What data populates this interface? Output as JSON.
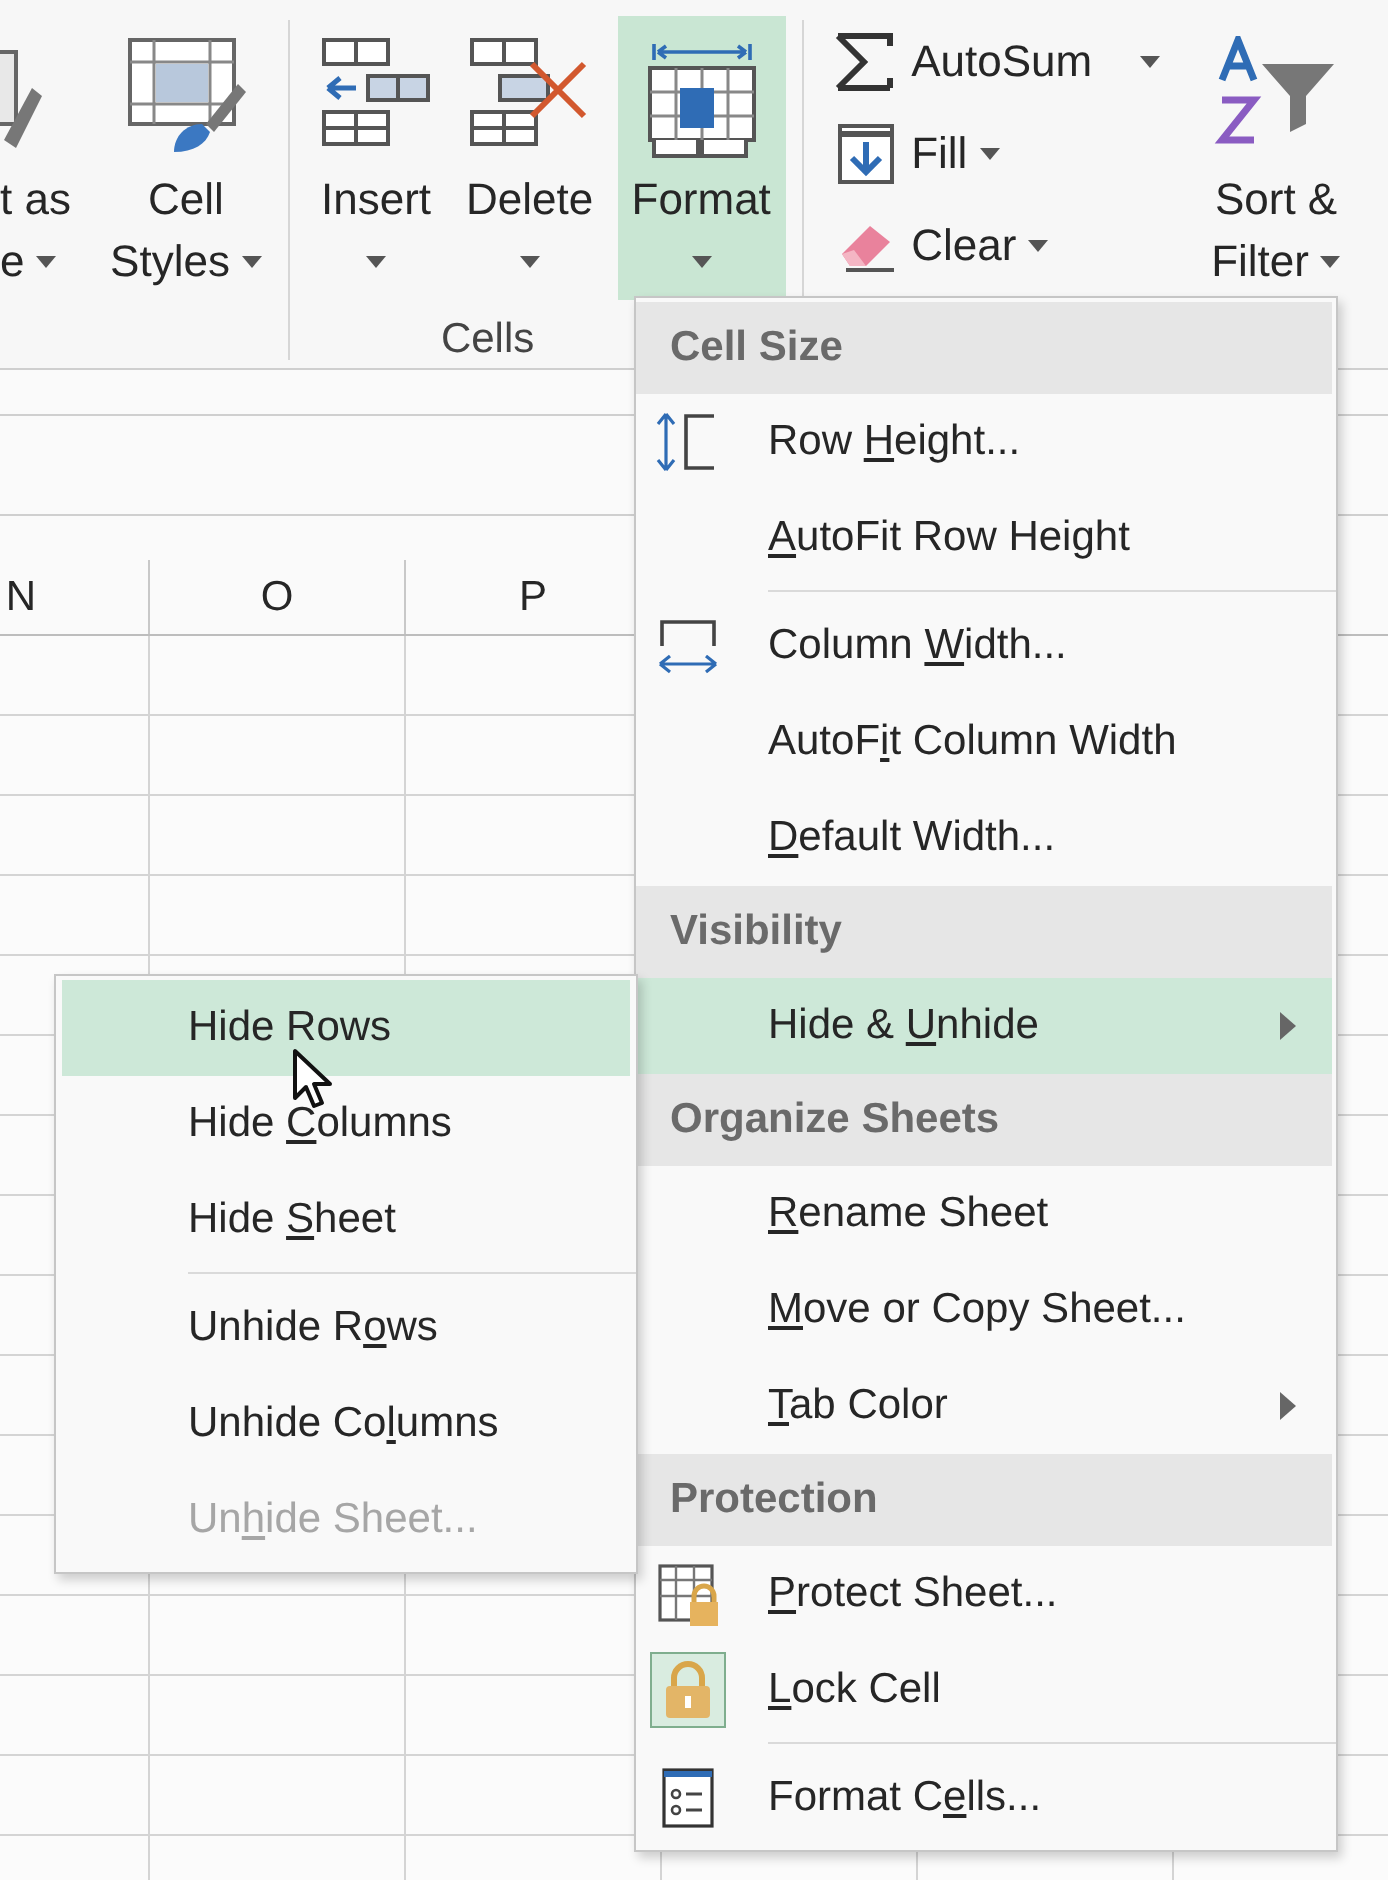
{
  "ribbon": {
    "styles_group": [
      {
        "kind": "table-style",
        "lines": [
          "t as",
          "e"
        ],
        "dropdown": true,
        "selected": false
      },
      {
        "kind": "cell-styles",
        "lines": [
          "Cell",
          "Styles"
        ],
        "dropdown": true,
        "selected": false
      }
    ],
    "cells_group": {
      "buttons": [
        {
          "kind": "insert",
          "lines": [
            "Insert"
          ],
          "dropdown": true,
          "selected": false
        },
        {
          "kind": "delete",
          "lines": [
            "Delete"
          ],
          "dropdown": true,
          "selected": false
        },
        {
          "kind": "format",
          "lines": [
            "Format"
          ],
          "dropdown": true,
          "selected": true
        }
      ],
      "label": "Cells"
    },
    "editing_group": {
      "small_buttons": [
        {
          "kind": "autosum",
          "label": "AutoSum",
          "dropdown": true
        },
        {
          "kind": "fill",
          "label": "Fill",
          "dropdown": true
        },
        {
          "kind": "clear",
          "label": "Clear",
          "dropdown": true
        }
      ],
      "sort_filter": {
        "kind": "sort-filter",
        "lines": [
          "Sort &",
          "Filter"
        ],
        "dropdown": true,
        "selected": false
      }
    }
  },
  "sheet": {
    "columns": [
      "N",
      "O",
      "P"
    ]
  },
  "format_menu": {
    "items": [
      {
        "kind": "header",
        "label": [
          {
            "t": "Cell Size"
          }
        ]
      },
      {
        "kind": "item",
        "label": [
          {
            "t": "Row "
          },
          {
            "u": "H"
          },
          {
            "t": "eight..."
          }
        ],
        "selected": false,
        "submenu": false,
        "checked": false
      },
      {
        "kind": "item",
        "label": [
          {
            "u": "A"
          },
          {
            "t": "utoFit Row Height"
          }
        ],
        "selected": false,
        "submenu": false,
        "checked": false
      },
      {
        "kind": "separator"
      },
      {
        "kind": "item",
        "label": [
          {
            "t": "Column "
          },
          {
            "u": "W"
          },
          {
            "t": "idth..."
          }
        ],
        "selected": false,
        "submenu": false,
        "checked": false
      },
      {
        "kind": "item",
        "label": [
          {
            "t": "AutoF"
          },
          {
            "u": "i"
          },
          {
            "t": "t Column Width"
          }
        ],
        "selected": false,
        "submenu": false,
        "checked": false
      },
      {
        "kind": "item",
        "label": [
          {
            "u": "D"
          },
          {
            "t": "efault Width..."
          }
        ],
        "selected": false,
        "submenu": false,
        "checked": false
      },
      {
        "kind": "header",
        "label": [
          {
            "t": "Visibility"
          }
        ]
      },
      {
        "kind": "item",
        "label": [
          {
            "t": "Hide & "
          },
          {
            "u": "U"
          },
          {
            "t": "nhide"
          }
        ],
        "selected": true,
        "submenu": true,
        "checked": false
      },
      {
        "kind": "header",
        "label": [
          {
            "t": "Organize Sheets"
          }
        ]
      },
      {
        "kind": "item",
        "label": [
          {
            "u": "R"
          },
          {
            "t": "ename Sheet"
          }
        ],
        "selected": false,
        "submenu": false,
        "checked": false
      },
      {
        "kind": "item",
        "label": [
          {
            "u": "M"
          },
          {
            "t": "ove or Copy Sheet..."
          }
        ],
        "selected": false,
        "submenu": false,
        "checked": false
      },
      {
        "kind": "item",
        "label": [
          {
            "u": "T"
          },
          {
            "t": "ab Color"
          }
        ],
        "selected": false,
        "submenu": true,
        "checked": false
      },
      {
        "kind": "header",
        "label": [
          {
            "t": "Protection"
          }
        ]
      },
      {
        "kind": "item",
        "label": [
          {
            "u": "P"
          },
          {
            "t": "rotect Sheet..."
          }
        ],
        "selected": false,
        "submenu": false,
        "checked": false
      },
      {
        "kind": "item",
        "label": [
          {
            "u": "L"
          },
          {
            "t": "ock Cell"
          }
        ],
        "selected": false,
        "submenu": false,
        "checked": true
      },
      {
        "kind": "separator"
      },
      {
        "kind": "item",
        "label": [
          {
            "t": "Format C"
          },
          {
            "u": "e"
          },
          {
            "t": "lls..."
          }
        ],
        "selected": false,
        "submenu": false,
        "checked": false
      }
    ]
  },
  "hide_unhide_menu": {
    "items": [
      {
        "kind": "item",
        "label": [
          {
            "t": "Hide Rows"
          }
        ],
        "selected": true,
        "disabled": false
      },
      {
        "kind": "item",
        "label": [
          {
            "t": "Hide "
          },
          {
            "u": "C"
          },
          {
            "t": "olumns"
          }
        ],
        "selected": false,
        "disabled": false
      },
      {
        "kind": "item",
        "label": [
          {
            "t": "Hide "
          },
          {
            "u": "S"
          },
          {
            "t": "heet"
          }
        ],
        "selected": false,
        "disabled": false
      },
      {
        "kind": "separator"
      },
      {
        "kind": "item",
        "label": [
          {
            "t": "Unhide R"
          },
          {
            "u": "o"
          },
          {
            "t": "ws"
          }
        ],
        "selected": false,
        "disabled": false
      },
      {
        "kind": "item",
        "label": [
          {
            "t": "Unhide Co"
          },
          {
            "u": "l"
          },
          {
            "t": "umns"
          }
        ],
        "selected": false,
        "disabled": false
      },
      {
        "kind": "item",
        "label": [
          {
            "t": "Un"
          },
          {
            "u": "h"
          },
          {
            "t": "ide Sheet..."
          }
        ],
        "selected": false,
        "disabled": true
      }
    ]
  }
}
